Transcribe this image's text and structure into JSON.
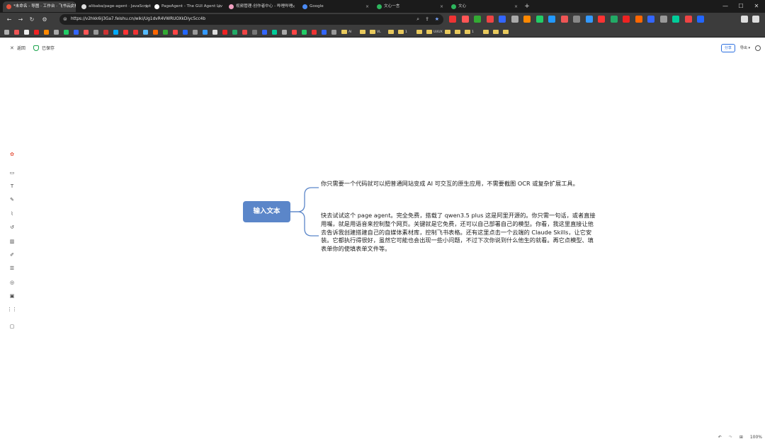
{
  "tabs": [
    {
      "title": "*未命名 - 导图 · 工作台 · 飞书云文档",
      "active": true,
      "favicon_color": "#e5533d"
    },
    {
      "title": "alibaba/page-agent · JavaScript in-page",
      "active": false,
      "favicon_color": "#dddddd"
    },
    {
      "title": "PageAgent - The GUI Agent Liv",
      "active": false,
      "favicon_color": "#ffffff"
    },
    {
      "title": "视频管理-创作者中心 - 哔哩哔哩",
      "active": false,
      "favicon_color": "#f0a0c0"
    },
    {
      "title": "Google",
      "active": false,
      "favicon_color": "#4a8af4"
    },
    {
      "title": "文心一言",
      "active": false,
      "favicon_color": "#2db55d"
    },
    {
      "title": "文心",
      "active": false,
      "favicon_color": "#2db55d"
    }
  ],
  "toolbar": {
    "url": "https://v2hkk6ij3Ga7.feishu.cn/wiki/Ug1dvR4VWRUOXkDiyc5cc4b",
    "back": "←",
    "forward": "→",
    "reload": "↻",
    "newtab": "+"
  },
  "bookmarks": [
    {
      "label": "",
      "color": "#b0b0b0"
    },
    {
      "label": "",
      "color": "#e55"
    },
    {
      "label": "",
      "color": "#eee"
    },
    {
      "label": "",
      "color": "#e22"
    },
    {
      "label": "",
      "color": "#f80"
    },
    {
      "label": "",
      "color": "#aaa"
    },
    {
      "label": "",
      "color": "#2c6"
    },
    {
      "label": "",
      "color": "#36f"
    },
    {
      "label": "",
      "color": "#f55"
    },
    {
      "label": "",
      "color": "#999"
    },
    {
      "label": "",
      "color": "#c33"
    },
    {
      "label": "",
      "color": "#0af"
    },
    {
      "label": "",
      "color": "#f33"
    },
    {
      "label": "",
      "color": "#e33"
    },
    {
      "label": "",
      "color": "#5bf"
    },
    {
      "label": "",
      "color": "#f60"
    },
    {
      "label": "",
      "color": "#3a3"
    },
    {
      "label": "",
      "color": "#f44"
    },
    {
      "label": "",
      "color": "#26f"
    },
    {
      "label": "",
      "color": "#999"
    },
    {
      "label": "",
      "color": "#39f"
    },
    {
      "label": "",
      "color": "#ddd"
    },
    {
      "label": "",
      "color": "#e22"
    },
    {
      "label": "",
      "color": "#2a6"
    },
    {
      "label": "",
      "color": "#e44"
    },
    {
      "label": "",
      "color": "#777"
    },
    {
      "label": "",
      "color": "#36f"
    },
    {
      "label": "",
      "color": "#0c9"
    },
    {
      "label": "",
      "color": "#aaa"
    },
    {
      "label": "",
      "color": "#f44"
    },
    {
      "label": "",
      "color": "#2c6"
    },
    {
      "label": "",
      "color": "#e33"
    },
    {
      "label": "",
      "color": "#36f"
    },
    {
      "label": "",
      "color": "#999"
    }
  ],
  "bookmark_folders": [
    "AI",
    "",
    "VL",
    "",
    "1",
    "",
    "UI/UX",
    "",
    "",
    "1",
    "",
    "",
    ""
  ],
  "header": {
    "back_label": "返回",
    "status_label": "已保存",
    "share_label": "分享",
    "export_label": "导出"
  },
  "mindmap": {
    "root": "输入文本",
    "children": [
      "你只需要一个代码就可以把普通网站变成 AI 可交互的原生应用，不需要截图 OCR 或复杂扩展工具。",
      "快去试试这个 page agent。完全免费，搭载了 qwen3.5 plus 这是阿里开源的。你只需一句话，或者直接用嘴，就是用语音来控制整个网页。关键就是它免费，还可以自己部署自己的模型。你看，我这里直接让他去告诉我创建搭建自己的自媒体素材库，控制飞书表格。还有这里点击一个云端的 Claude Skills，让它安装。它都执行得很好，虽然它可能也会出现一些小问题，不过下次你说到什么他生的就看。再它点模型、填表单你的使填表单文件等。"
    ],
    "root_color": "#5b86c9",
    "connector_color": "#5b86c9"
  },
  "left_rail": [
    "ai-icon",
    "rect-icon",
    "text-icon",
    "pen-icon",
    "mark-icon",
    "undo-icon",
    "frame-icon",
    "brush-icon",
    "list-icon",
    "eye-icon",
    "image-icon",
    "grid-icon",
    "more-icon"
  ],
  "bottom": {
    "zoom": "100%"
  }
}
